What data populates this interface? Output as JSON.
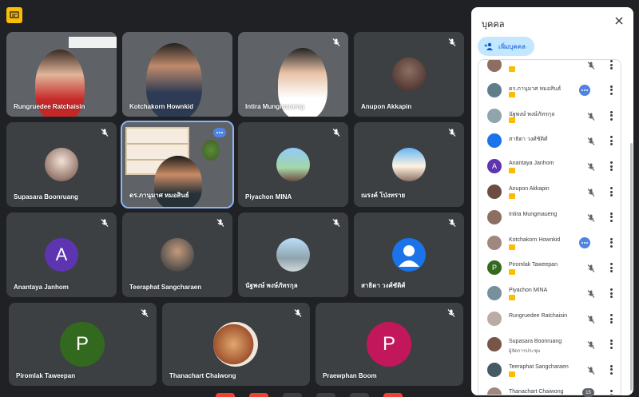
{
  "panel": {
    "title": "บุคคล",
    "add_button_label": "เพิ่มบุคคล",
    "participant_count": "15",
    "participants": [
      {
        "name": "",
        "sub": "",
        "avatar_letter": "",
        "avatar_color": "#8d6e63",
        "badge": true,
        "muted": true,
        "speaking": false
      },
      {
        "name": "ดร.ภานุมาศ หมอสินธ์",
        "sub": "",
        "avatar_letter": "",
        "avatar_color": "#607d8b",
        "badge": true,
        "muted": false,
        "speaking": true
      },
      {
        "name": "นัฐพงษ์ พงษ์ภัทรกุล",
        "sub": "",
        "avatar_letter": "",
        "avatar_color": "#90a4ae",
        "badge": true,
        "muted": true,
        "speaking": false
      },
      {
        "name": "สาธิตา วงศ์ชัติศ์",
        "sub": "",
        "avatar_letter": "",
        "avatar_color": "#1a73e8",
        "badge": false,
        "muted": true,
        "speaking": false
      },
      {
        "name": "Anantaya Janhom",
        "sub": "",
        "avatar_letter": "A",
        "avatar_color": "#5e35b1",
        "badge": true,
        "muted": true,
        "speaking": false
      },
      {
        "name": "Anupon Akkapin",
        "sub": "",
        "avatar_letter": "",
        "avatar_color": "#6d4c41",
        "badge": true,
        "muted": true,
        "speaking": false
      },
      {
        "name": "Intira Mungmaueng",
        "sub": "",
        "avatar_letter": "",
        "avatar_color": "#8d6e63",
        "badge": false,
        "muted": true,
        "speaking": false
      },
      {
        "name": "Kotchakorn Hownkid",
        "sub": "",
        "avatar_letter": "",
        "avatar_color": "#a1887f",
        "badge": true,
        "muted": false,
        "speaking": true
      },
      {
        "name": "Piromlak Taweepan",
        "sub": "",
        "avatar_letter": "P",
        "avatar_color": "#33691e",
        "badge": true,
        "muted": true,
        "speaking": false
      },
      {
        "name": "Piyachon MINA",
        "sub": "",
        "avatar_letter": "",
        "avatar_color": "#78909c",
        "badge": true,
        "muted": true,
        "speaking": false
      },
      {
        "name": "Rungruedee Ratchaisin",
        "sub": "",
        "avatar_letter": "",
        "avatar_color": "#bcaaa4",
        "badge": false,
        "muted": true,
        "speaking": false
      },
      {
        "name": "Supasara Boonruang",
        "sub": "ผู้จัดการประชุม",
        "avatar_letter": "",
        "avatar_color": "#795548",
        "badge": false,
        "muted": true,
        "speaking": false
      },
      {
        "name": "Teeraphat Sangcharaen",
        "sub": "",
        "avatar_letter": "",
        "avatar_color": "#455a64",
        "badge": true,
        "muted": true,
        "speaking": false
      },
      {
        "name": "Thanachart Chaiwong",
        "sub": "",
        "avatar_letter": "",
        "avatar_color": "#a1887f",
        "badge": false,
        "muted": true,
        "speaking": false
      }
    ]
  },
  "tiles": [
    {
      "name": "Rungruedee Ratchaisin"
    },
    {
      "name": "Kotchakorn Hownkid"
    },
    {
      "name": "Intira Mungmaueng"
    },
    {
      "name": "Anupon Akkapin"
    },
    {
      "name": "Supasara Boonruang"
    },
    {
      "name": "ดร.ภานุมาศ หมอสินธ์"
    },
    {
      "name": "Piyachon MINA"
    },
    {
      "name": "ณรงค์ โป่งทราย"
    },
    {
      "name": "Anantaya Janhom",
      "letter": "A"
    },
    {
      "name": "Teeraphat Sangcharaen"
    },
    {
      "name": "นัฐพงษ์ พงษ์ภัทรกุล"
    },
    {
      "name": "สาธิตา วงศ์ชัติศ์"
    },
    {
      "name": "Piromlak Taweepan",
      "letter": "P"
    },
    {
      "name": "Thanachart Chaiwong"
    },
    {
      "name": "Praewphan Boom",
      "letter": "P"
    }
  ],
  "colors": {
    "accent_blue": "#8ab4f8",
    "avatar_purple": "#5e35b1",
    "avatar_green": "#33691e",
    "avatar_pink": "#c2185b",
    "avatar_blue": "#1a73e8"
  }
}
